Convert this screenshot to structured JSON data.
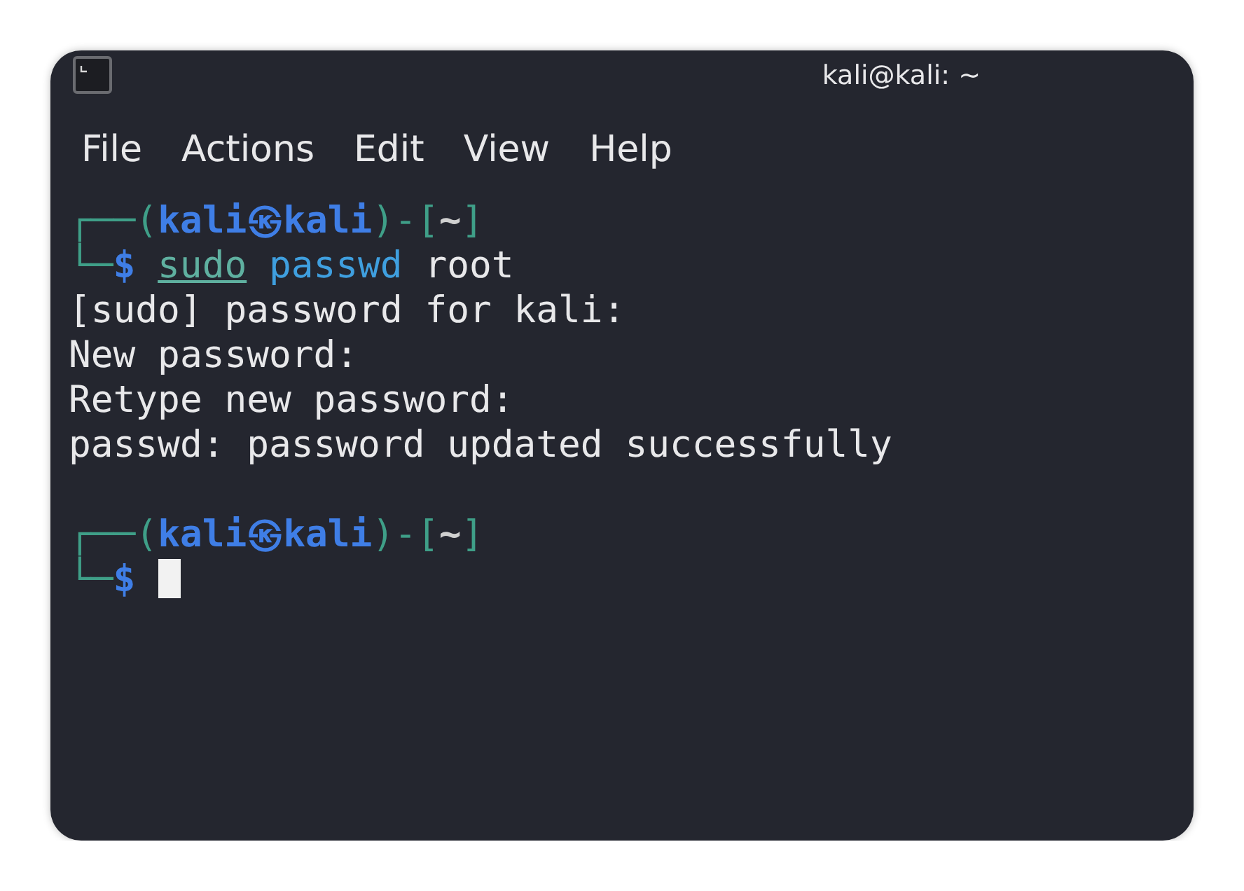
{
  "window": {
    "title": "kali@kali: ~"
  },
  "menu": [
    "File",
    "Actions",
    "Edit",
    "View",
    "Help"
  ],
  "terminal": [
    {
      "kind": "prompt-top",
      "segments": [
        {
          "text": "┌──(",
          "kind": "frame"
        },
        {
          "text": "kali㉿kali",
          "kind": "userhost"
        },
        {
          "text": ")-[",
          "kind": "frame"
        },
        {
          "text": "~",
          "kind": "dir"
        },
        {
          "text": "]",
          "kind": "frame"
        }
      ]
    },
    {
      "kind": "prompt-bottom",
      "segments": [
        {
          "text": "└─",
          "kind": "frame"
        },
        {
          "text": "$",
          "kind": "sign"
        },
        {
          "text": "sudo",
          "kind": "underlined"
        },
        {
          "text": "passwd",
          "kind": "command"
        },
        {
          "text": "root",
          "kind": "plain"
        }
      ],
      "cursor": false
    },
    {
      "kind": "output",
      "text": "[sudo] password for kali:"
    },
    {
      "kind": "output",
      "text": "New password:"
    },
    {
      "kind": "output",
      "text": "Retype new password:"
    },
    {
      "kind": "output",
      "text": "passwd: password updated successfully"
    },
    {
      "kind": "blank"
    },
    {
      "kind": "prompt-top",
      "segments": [
        {
          "text": "┌──(",
          "kind": "frame"
        },
        {
          "text": "kali㉿kali",
          "kind": "userhost"
        },
        {
          "text": ")-[",
          "kind": "frame"
        },
        {
          "text": "~",
          "kind": "dir"
        },
        {
          "text": "]",
          "kind": "frame"
        }
      ]
    },
    {
      "kind": "prompt-bottom",
      "segments": [
        {
          "text": "└─",
          "kind": "frame"
        },
        {
          "text": "$",
          "kind": "sign"
        }
      ],
      "cursor": true
    }
  ]
}
